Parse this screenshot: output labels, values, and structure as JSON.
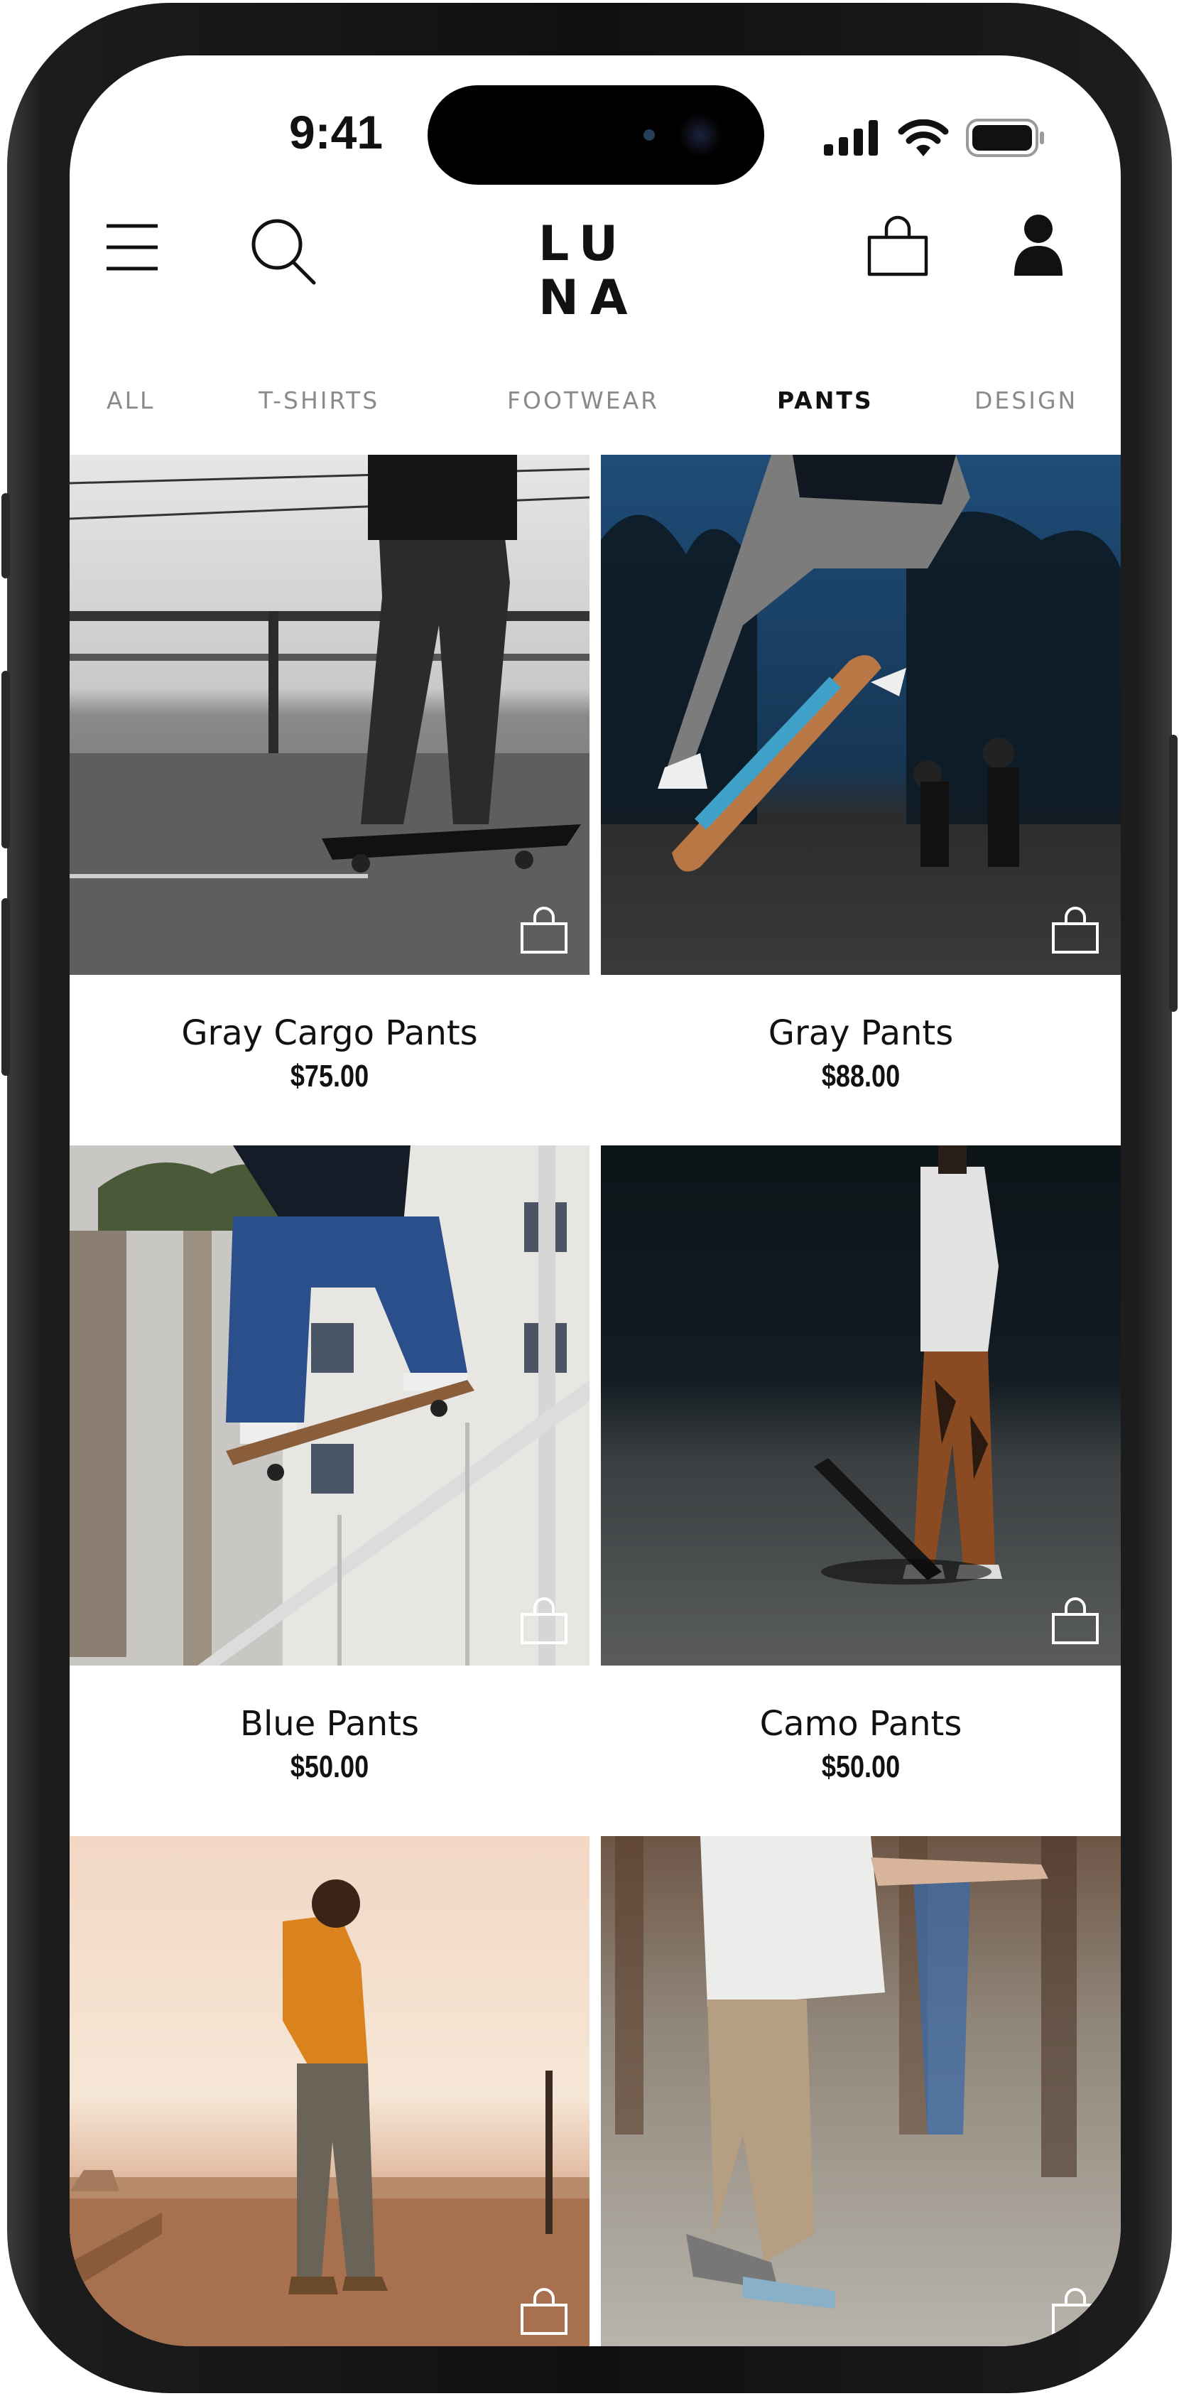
{
  "status_bar": {
    "time": "9:41"
  },
  "header": {
    "logo_line1": "LU",
    "logo_line2": "NA"
  },
  "tabs": [
    {
      "label": "ALL"
    },
    {
      "label": "T-SHIRTS"
    },
    {
      "label": "FOOTWEAR"
    },
    {
      "label": "PANTS",
      "active": true
    },
    {
      "label": "DESIGN"
    }
  ],
  "products": [
    {
      "name": "Gray Cargo Pants",
      "price": "$75.00"
    },
    {
      "name": "Gray Pants",
      "price": "$88.00"
    },
    {
      "name": "Blue Pants",
      "price": "$50.00"
    },
    {
      "name": "Camo Pants",
      "price": "$50.00"
    },
    {
      "name": "",
      "price": ""
    },
    {
      "name": "",
      "price": ""
    }
  ],
  "icons": {
    "menu": "hamburger-menu-icon",
    "search": "search-icon",
    "cart": "shopping-bag-icon",
    "account": "user-icon",
    "add_to_bag": "shopping-bag-icon"
  },
  "colors": {
    "text": "#111111",
    "muted": "#8a8a8a",
    "background": "#ffffff"
  }
}
